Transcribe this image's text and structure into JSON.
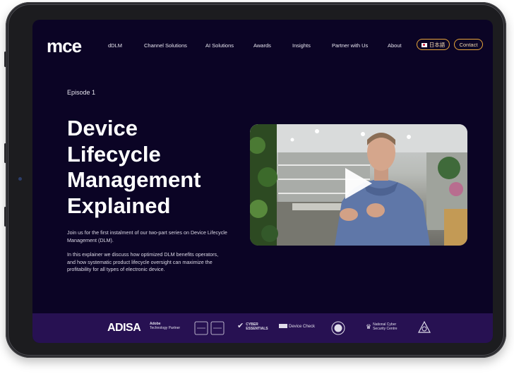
{
  "nav": {
    "logo": "mce",
    "links": [
      "dDLM",
      "Channel Solutions",
      "AI Solutions",
      "Awards",
      "Insights",
      "Partner with Us",
      "About"
    ],
    "language_label": "日本語",
    "contact_label": "Contact"
  },
  "hero": {
    "episode": "Episode 1",
    "title_lines": [
      "Device",
      "Lifecycle",
      "Management",
      "Explained"
    ],
    "paragraph_1": "Join us for the first instalment of our two-part series on Device Lifecycle Management (DLM).",
    "paragraph_2": "In this explainer we discuss how optimized DLM benefits operators, and how systematic product lifecycle oversight can maximize the profitability for all types of electronic device."
  },
  "video": {
    "icon": "play-icon"
  },
  "footer": {
    "badges": {
      "adisa": "ADISA",
      "adobe_line1": "Adobe",
      "adobe_line2": "Technology Partner",
      "cyber_line1": "CYBER",
      "cyber_line2": "ESSENTIALS",
      "device_check": "Device Check",
      "ncsc_line1": "National Cyber",
      "ncsc_line2": "Security Centre"
    }
  },
  "colors": {
    "background": "#0b0425",
    "footer": "#271152",
    "accent": "#e9a63a"
  }
}
